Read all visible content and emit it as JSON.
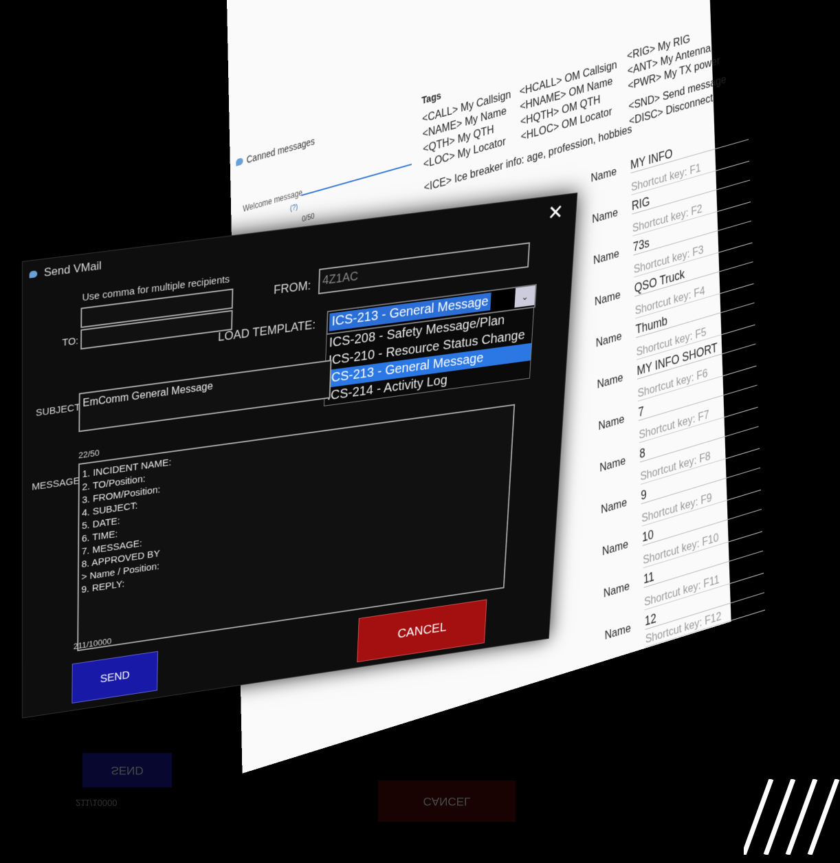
{
  "canned": {
    "title": "Canned messages",
    "close_glyph": "✕",
    "welcome_label": "Welcome message",
    "help_link": "(?)",
    "counter": "0/50",
    "tags_title": "Tags",
    "tags": [
      "<CALL> My Callsign",
      "<NAME> My Name",
      "<QTH>  My QTH",
      "<LOC>  My Locator",
      "<HCALL> OM Callsign",
      "<HNAME> OM Name",
      "<HQTH>  OM QTH",
      "<HLOC>  OM Locator",
      "<RIG>  My RIG",
      "<ANT> My Antenna",
      "<PWR> My TX power",
      "<SND> Send message",
      "<DISC> Disconnect",
      "<ICE>  Ice breaker info: age, profession, hobbies"
    ],
    "name_label": "Name",
    "rows": [
      {
        "value": "MY INFO",
        "key": "Shortcut key: F1"
      },
      {
        "value": "RIG",
        "key": "Shortcut key: F2"
      },
      {
        "value": "73s",
        "key": "Shortcut key: F3"
      },
      {
        "value": "QSO Truck",
        "key": "Shortcut key: F4"
      },
      {
        "value": "Thumb",
        "key": "Shortcut key: F5"
      },
      {
        "value": "MY INFO SHORT",
        "key": "Shortcut key: F6"
      },
      {
        "value": "7",
        "key": "Shortcut key: F7"
      },
      {
        "value": "8",
        "key": "Shortcut key: F8"
      },
      {
        "value": "9",
        "key": "Shortcut key: F9"
      },
      {
        "value": "10",
        "key": "Shortcut key: F10"
      },
      {
        "value": "11",
        "key": "Shortcut key: F11"
      },
      {
        "value": "12",
        "key": "Shortcut key: F12"
      }
    ]
  },
  "vmail": {
    "title": "Send VMail",
    "close_glyph": "✕",
    "to_hint": "Use comma for multiple recipients",
    "to_label": "TO:",
    "from_label": "FROM:",
    "from_value": "4Z1AC",
    "load_template_label": "LOAD TEMPLATE:",
    "template_selected": "ICS-213 - General Message",
    "template_options": [
      "ICS-208 - Safety Message/Plan",
      "ICS-210 - Resource Status Change",
      "ICS-213 - General Message",
      "ICS-214 - Activity Log"
    ],
    "subject_label": "SUBJECT:",
    "subject_value": "EmComm General Message",
    "subject_counter": "22/50",
    "message_label": "MESSAGE:",
    "message_lines": [
      "1. INCIDENT NAME:",
      "",
      "2. TO/Position:",
      "3. FROM/Position:",
      "4. SUBJECT:",
      "5. DATE:",
      "6. TIME:",
      "7. MESSAGE:",
      "",
      "8. APPROVED BY",
      "> Name / Position:",
      "",
      "9. REPLY:"
    ],
    "message_counter": "211/10000",
    "send_label": "SEND",
    "cancel_label": "CANCEL",
    "colors": {
      "send": "#1919a8",
      "cancel": "#a40f0f",
      "highlight": "#2b78e4"
    }
  }
}
